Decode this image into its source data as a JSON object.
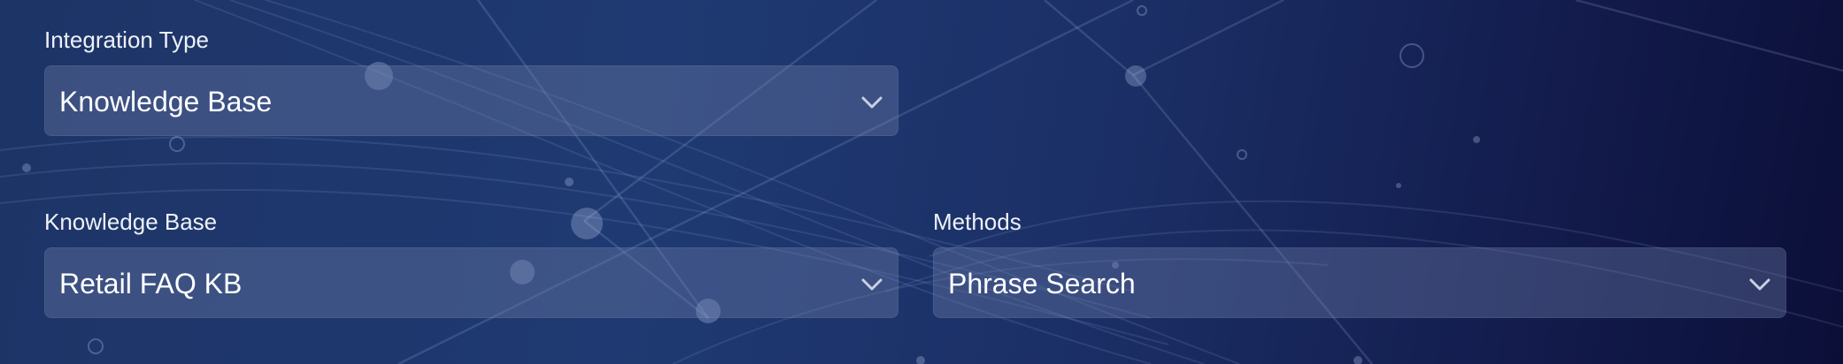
{
  "form": {
    "integration_type": {
      "label": "Integration Type",
      "value": "Knowledge Base"
    },
    "knowledge_base": {
      "label": "Knowledge Base",
      "value": "Retail FAQ KB"
    },
    "methods": {
      "label": "Methods",
      "value": "Phrase Search"
    }
  },
  "icons": {
    "dropdown": "chevron-down-icon"
  },
  "colors": {
    "background_start": "#1d3466",
    "background_end": "#0b0f38",
    "field_fill": "rgba(110,125,170,0.38)",
    "text": "#ffffff"
  }
}
